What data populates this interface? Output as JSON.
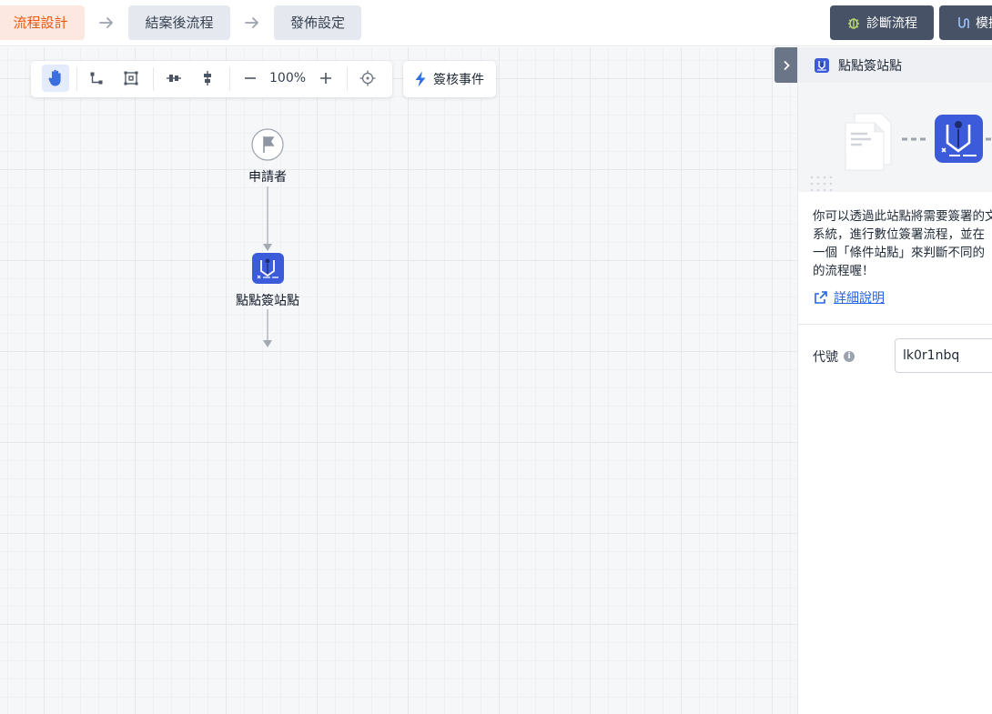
{
  "header": {
    "steps": [
      {
        "label": "流程設計"
      },
      {
        "label": "結案後流程"
      },
      {
        "label": "發佈設定"
      }
    ],
    "diagnose_label": "診斷流程",
    "simulate_label": "模擬"
  },
  "toolbar": {
    "zoom": "100%",
    "event_label": "簽核事件"
  },
  "flow": {
    "start_label": "申請者",
    "sign_label": "點點簽站點"
  },
  "panel": {
    "title": "點點簽站點",
    "description": "你可以透過此站點將需要簽署的文\n系統，進行數位簽署流程，並在\n一個「條件站點」來判斷不同的\n的流程喔！",
    "more_link": "詳細說明",
    "field_label": "代號",
    "field_value": "lk0r1nbq"
  },
  "colors": {
    "accent": "#ea580c",
    "brand_blue": "#3b5bdb",
    "button_dark": "#475266"
  }
}
